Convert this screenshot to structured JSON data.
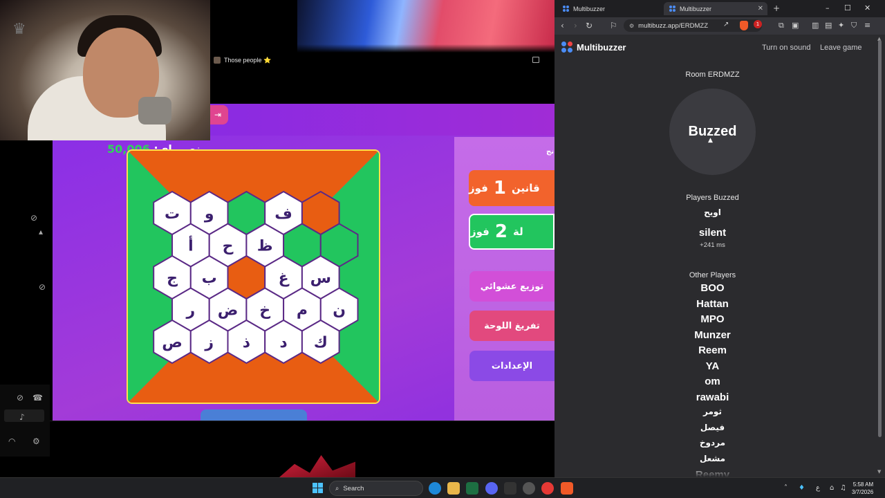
{
  "stream": {
    "tab_title": "Those people ⭐",
    "score_label": "نصوراي:",
    "score_value": "50,006",
    "teams": [
      {
        "name_fragment": "قانين",
        "score": "1",
        "wins_label": "فوز"
      },
      {
        "name_fragment": "لة",
        "score": "2",
        "wins_label": "فوز"
      }
    ],
    "actions": [
      {
        "label": "توزيع عشوائي"
      },
      {
        "label": "تفريغ اللوحة"
      },
      {
        "label": "الإعدادات"
      }
    ],
    "panel_label": "نج",
    "board_letters": [
      [
        "ت",
        "و",
        "",
        "ف",
        ""
      ],
      [
        "أ",
        "ح",
        "ظ",
        "",
        ""
      ],
      [
        "ج",
        "ب",
        "",
        "غ",
        "س"
      ],
      [
        "ر",
        "ض",
        "خ",
        "م",
        "ن"
      ],
      [
        "ص",
        "ز",
        "ذ",
        "د",
        "ك"
      ]
    ],
    "board_fills": [
      [
        "white",
        "white",
        "green",
        "white",
        "orange"
      ],
      [
        "white",
        "white",
        "white",
        "green",
        "green"
      ],
      [
        "white",
        "white",
        "orange",
        "white",
        "white"
      ],
      [
        "white",
        "white",
        "white",
        "white",
        "white"
      ],
      [
        "white",
        "white",
        "white",
        "white",
        "white"
      ]
    ],
    "colors": {
      "orange": "#e85d12",
      "green": "#22c55e",
      "letter": "#3b1f6e",
      "frame": "#ffe14d"
    }
  },
  "browser": {
    "tabs": [
      {
        "label": "Multibuzzer",
        "active": false
      },
      {
        "label": "Multibuzzer",
        "active": true
      }
    ],
    "url": "multibuzz.app/ERDMZZ",
    "shields_count": "1"
  },
  "app": {
    "brand": "Multibuzzer",
    "sound_link": "Turn on sound",
    "leave_link": "Leave game",
    "room": "Room ERDMZZ",
    "buzz_button": "Buzzed",
    "buzzed_title": "Players Buzzed",
    "buzzed": [
      {
        "name": "اويح",
        "delta": ""
      },
      {
        "name": "silent",
        "delta": "+241 ms"
      }
    ],
    "others_title": "Other Players",
    "others": [
      "BOO",
      "Hattan",
      "MPO",
      "Munzer",
      "Reem",
      "YA",
      "om",
      "rawabi",
      "ثومر",
      "فيصل",
      "مردوخ",
      "مشعل",
      "Reemy"
    ],
    "logo_colors": [
      "#4b8cf5",
      "#ef4444",
      "#4b8cf5",
      "#4b8cf5"
    ]
  },
  "taskbar": {
    "search_placeholder": "Search",
    "time": "5:58 AM",
    "date": "3/7/2026",
    "ime": "ع"
  }
}
